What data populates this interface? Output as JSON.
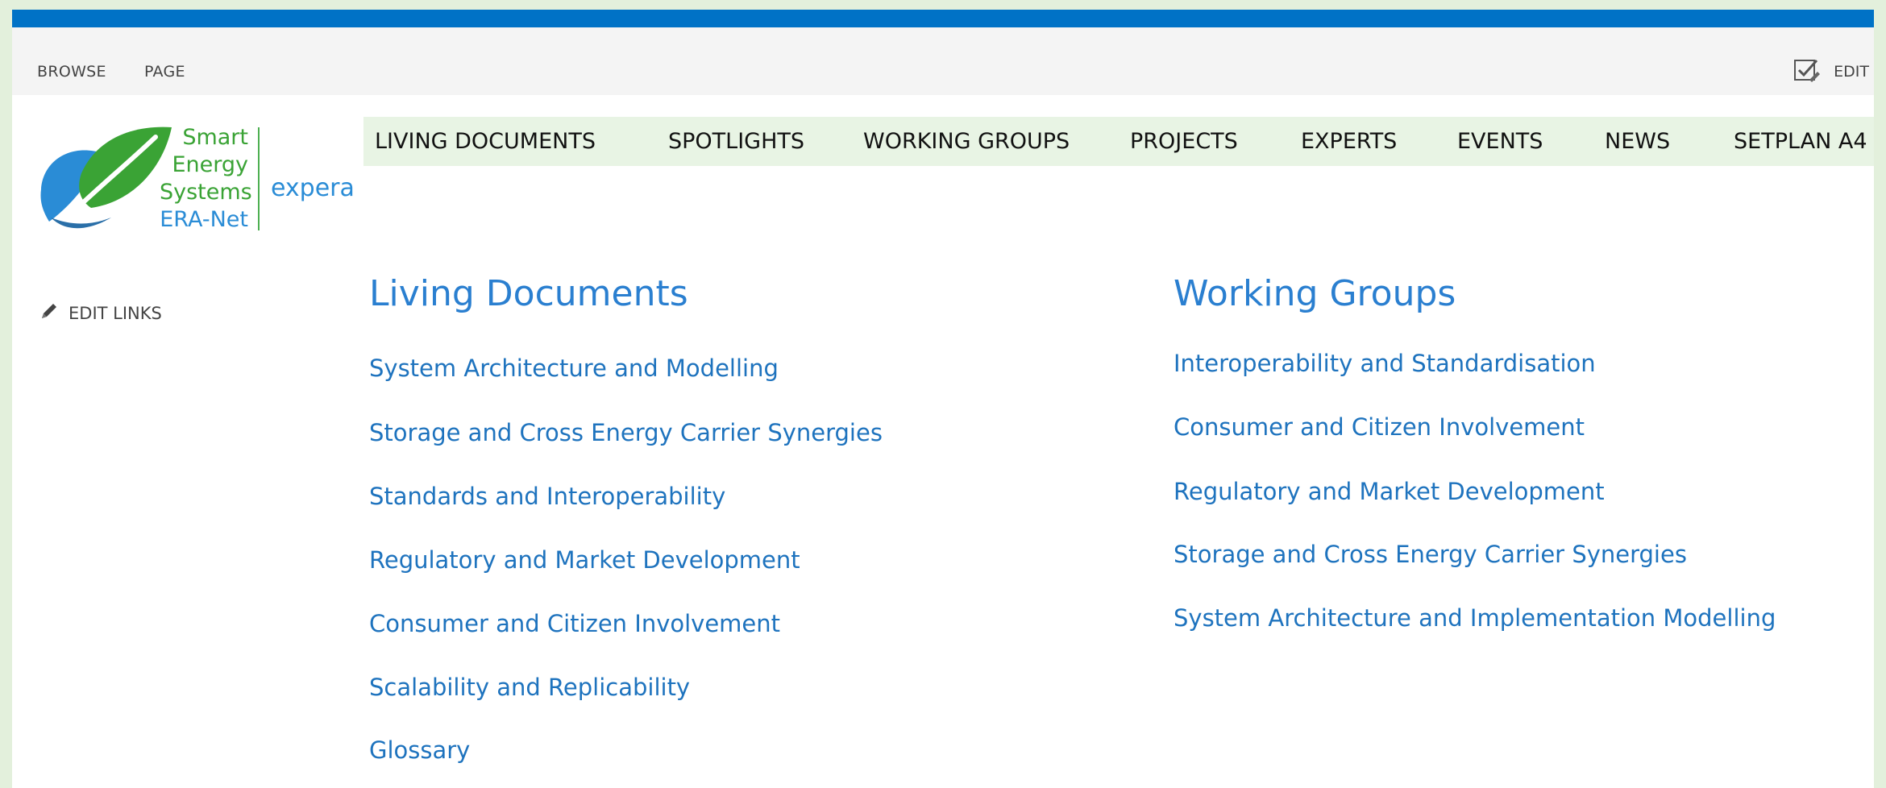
{
  "ribbon": {
    "tabs": [
      "BROWSE",
      "PAGE"
    ],
    "edit_label": "EDIT"
  },
  "logo": {
    "lines": [
      "Smart",
      "Energy",
      "Systems",
      "ERA-Net"
    ],
    "brand": "expera"
  },
  "nav": {
    "items": [
      "LIVING DOCUMENTS",
      "SPOTLIGHTS",
      "WORKING GROUPS",
      "PROJECTS",
      "EXPERTS",
      "EVENTS",
      "NEWS",
      "SETPLAN A4"
    ]
  },
  "sidebar": {
    "edit_links_label": "EDIT LINKS"
  },
  "living_documents": {
    "title": "Living Documents",
    "links": [
      "System Architecture and Modelling",
      "Storage and Cross Energy Carrier Synergies",
      "Standards and Interoperability",
      "Regulatory and Market Development",
      "Consumer and Citizen Involvement",
      "Scalability and Replicability",
      "Glossary"
    ]
  },
  "working_groups": {
    "title": "Working Groups",
    "links": [
      "Interoperability and Standardisation",
      "Consumer and Citizen Involvement",
      "Regulatory and Market Development",
      "Storage and Cross Energy Carrier Synergies",
      "System Architecture and Implementation Modelling"
    ]
  },
  "colors": {
    "suite_bar": "#0072c6",
    "link": "#1e73be",
    "nav_background": "#e8f4e4",
    "logo_green": "#3aa335",
    "logo_blue": "#2a8cd6"
  }
}
